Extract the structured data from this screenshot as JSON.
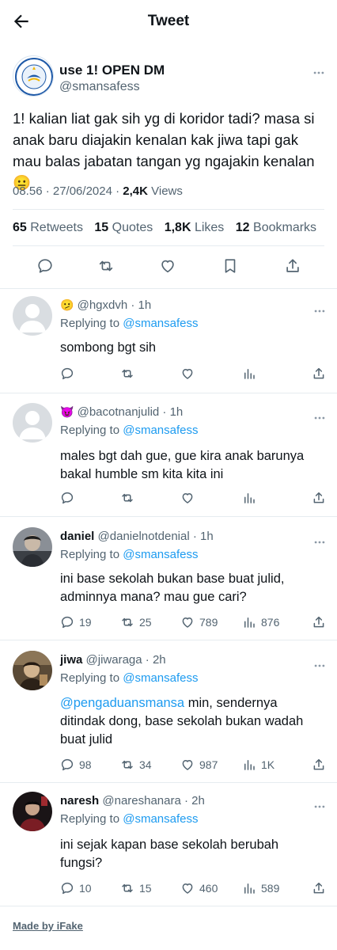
{
  "header": {
    "title": "Tweet"
  },
  "tweet": {
    "author_name": "use 1! OPEN DM",
    "author_handle": "@smansafess",
    "avatar_text_top": "SMA NEGERI 1",
    "avatar_text_bottom": "JAKARTA",
    "text": "1! kalian liat gak sih yg di koridor tadi? masa si anak baru diajakin kenalan kak jiwa tapi gak mau balas jabatan tangan yg ngajakin kenalan 😐",
    "time": "08.56 · 27/06/2024 · ",
    "views_count": "2,4K",
    "views_label": " Views",
    "stats": {
      "retweets_count": "65",
      "retweets_label": "Retweets",
      "quotes_count": "15",
      "quotes_label": "Quotes",
      "likes_count": "1,8K",
      "likes_label": "Likes",
      "bookmarks_count": "12",
      "bookmarks_label": "Bookmarks"
    }
  },
  "replies": [
    {
      "emoji": "🫤",
      "name": "",
      "handle": "@hgxdvh",
      "time": " · 1h",
      "replying_label": "Replying to ",
      "replying_to": "@smansafess",
      "mention": "",
      "text": "sombong bgt sih",
      "replies": "",
      "retweets": "",
      "likes": "",
      "views": ""
    },
    {
      "emoji": "😈",
      "name": "",
      "handle": "@bacotnanjulid",
      "time": " · 1h",
      "replying_label": "Replying to ",
      "replying_to": "@smansafess",
      "mention": "",
      "text": "males bgt dah gue, gue kira anak barunya bakal humble sm kita kita ini",
      "replies": "",
      "retweets": "",
      "likes": "",
      "views": ""
    },
    {
      "emoji": "",
      "name": "daniel",
      "handle": "@danielnotdenial",
      "time": " · 1h",
      "replying_label": "Replying to ",
      "replying_to": "@smansafess",
      "mention": "",
      "text": "ini base sekolah bukan base buat julid, adminnya mana? mau gue cari?",
      "replies": "19",
      "retweets": "25",
      "likes": "789",
      "views": "876"
    },
    {
      "emoji": "",
      "name": "jiwa",
      "handle": "@jiwaraga",
      "time": " · 2h",
      "replying_label": "Replying to ",
      "replying_to": "@smansafess",
      "mention": "@pengaduansmansa",
      "text": " min, sendernya ditindak dong, base sekolah bukan wadah buat julid",
      "replies": "98",
      "retweets": "34",
      "likes": "987",
      "views": "1K"
    },
    {
      "emoji": "",
      "name": "naresh",
      "handle": "@nareshanara",
      "time": " · 2h",
      "replying_label": "Replying to ",
      "replying_to": "@smansafess",
      "mention": "",
      "text": "ini sejak kapan base sekolah berubah fungsi?",
      "replies": "10",
      "retweets": "15",
      "likes": "460",
      "views": "589"
    }
  ],
  "footer": {
    "text": "Made by iFake"
  },
  "colors": {
    "link": "#1d9bf0",
    "muted": "#536471",
    "text": "#0f1419",
    "border": "#e6ecf0"
  }
}
